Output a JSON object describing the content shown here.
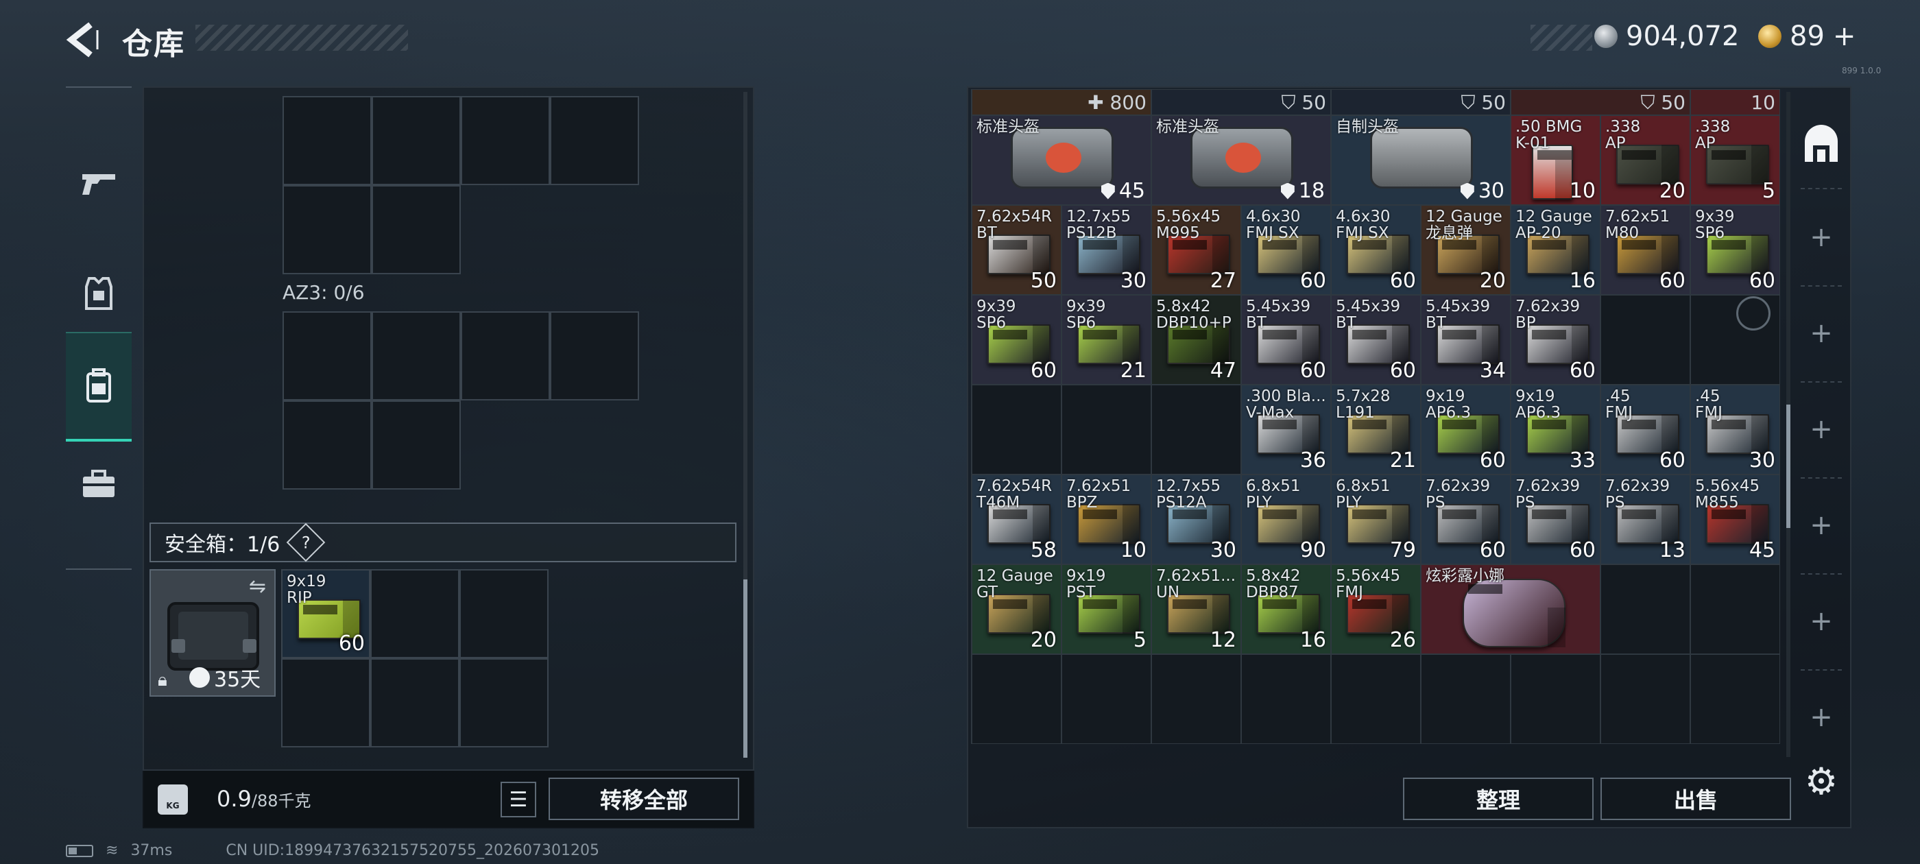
{
  "header": {
    "title": "仓库",
    "silver_amount": "904,072",
    "gold_amount": "89",
    "gold_plus": "+",
    "version": "899 1.0.0"
  },
  "left": {
    "az3_label": "AZ3: 0/6",
    "safebox_label": "安全箱：1/6",
    "safebox_help": "?",
    "safebox_days": "35天",
    "safe_item": {
      "name": "9x19\nRIP",
      "qty": "60"
    },
    "weight_value": "0.9",
    "weight_max": "/88千克",
    "kg_label": "KG",
    "transfer_all": "转移全部"
  },
  "right": {
    "sort_label": "整理",
    "sell_label": "出售",
    "top_row": [
      {
        "value": "800",
        "kind": "plus"
      },
      {
        "value": "50",
        "kind": "shield"
      },
      {
        "value": "50",
        "kind": "shield"
      },
      {
        "value": "50",
        "kind": "shield"
      },
      {
        "value": "10",
        "kind": "plain"
      }
    ],
    "helmets": [
      {
        "name": "标准头盔",
        "qty": "45"
      },
      {
        "name": "标准头盔",
        "qty": "18"
      },
      {
        "name": "自制头盔",
        "qty": "30"
      }
    ],
    "row1_small": [
      {
        "name": ".50 BMG\nK-01",
        "qty": "10"
      },
      {
        "name": ".338\nAP",
        "qty": "20"
      },
      {
        "name": ".338\nAP",
        "qty": "5"
      }
    ],
    "row2": [
      {
        "name": "7.62x54R\nBT",
        "qty": "50"
      },
      {
        "name": "12.7x55\nPS12B",
        "qty": "30"
      },
      {
        "name": "5.56x45\nM995",
        "qty": "27"
      },
      {
        "name": "4.6x30\nFMJ SX",
        "qty": "60"
      },
      {
        "name": "4.6x30\nFMJ SX",
        "qty": "60"
      },
      {
        "name": "12 Gauge\n龙息弹",
        "qty": "20"
      },
      {
        "name": "12 Gauge\nAP-20",
        "qty": "16"
      },
      {
        "name": "7.62x51\nM80",
        "qty": "60"
      },
      {
        "name": "9x39\nSP6",
        "qty": "60"
      }
    ],
    "row3": [
      {
        "name": "9x39\nSP6",
        "qty": "60"
      },
      {
        "name": "9x39\nSP6",
        "qty": "21"
      },
      {
        "name": "5.8x42\nDBP10+P",
        "qty": "47"
      },
      {
        "name": "5.45x39\nBT",
        "qty": "60"
      },
      {
        "name": "5.45x39\nBT",
        "qty": "60"
      },
      {
        "name": "5.45x39\nBT",
        "qty": "34"
      },
      {
        "name": "7.62x39\nBP",
        "qty": "60"
      }
    ],
    "row4": [
      {
        "name": ".300 Bla...\nV-Max",
        "qty": "36"
      },
      {
        "name": "5.7x28\nL191",
        "qty": "21"
      },
      {
        "name": "9x19\nAP6.3",
        "qty": "60"
      },
      {
        "name": "9x19\nAP6.3",
        "qty": "33"
      },
      {
        "name": ".45\nFMJ",
        "qty": "60"
      },
      {
        "name": ".45\nFMJ",
        "qty": "30"
      }
    ],
    "row5": [
      {
        "name": "7.62x54R\nT46M",
        "qty": "58"
      },
      {
        "name": "7.62x51\nBPZ",
        "qty": "10"
      },
      {
        "name": "12.7x55\nPS12A",
        "qty": "30"
      },
      {
        "name": "6.8x51\nPLY",
        "qty": "90"
      },
      {
        "name": "6.8x51\nPLY",
        "qty": "79"
      },
      {
        "name": "7.62x39\nPS",
        "qty": "60"
      },
      {
        "name": "7.62x39\nPS",
        "qty": "60"
      },
      {
        "name": "7.62x39\nPS",
        "qty": "13"
      },
      {
        "name": "5.56x45\nM855",
        "qty": "45"
      }
    ],
    "row6": [
      {
        "name": "12 Gauge\nGT",
        "qty": "20"
      },
      {
        "name": "9x19\nPST",
        "qty": "5"
      },
      {
        "name": "7.62x51...\nUN",
        "qty": "12"
      },
      {
        "name": "5.8x42\nDBP87",
        "qty": "16"
      },
      {
        "name": "5.56x45\nFMJ",
        "qty": "26"
      },
      {
        "name": "炫彩露小娜",
        "qty": ""
      }
    ]
  },
  "status": {
    "ping": "37ms",
    "uid": "CN UID:18994737632157520755_202607301205"
  }
}
